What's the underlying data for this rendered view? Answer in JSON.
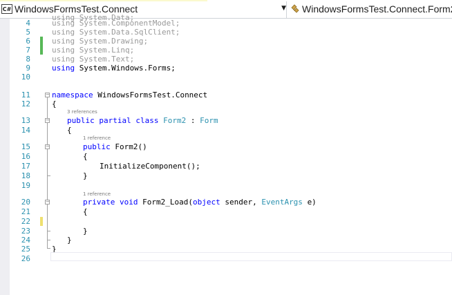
{
  "navbar": {
    "project_badge": "C#",
    "project": "WindowsFormsTest.Connect",
    "class_name": "WindowsFormsTest.Connect.Form2",
    "accent_color": "#007acc"
  },
  "editor": {
    "lines": [
      {
        "n": "4",
        "text": "using System.ComponentModel;"
      },
      {
        "n": "5",
        "text": "using System.Data.SqlClient;"
      },
      {
        "n": "6",
        "text": "using System.Drawing;"
      },
      {
        "n": "7",
        "text": "using System.Linq;"
      },
      {
        "n": "8",
        "text": "using System.Text;"
      },
      {
        "n": "9",
        "text": "using System.Windows.Forms;"
      },
      {
        "n": "10",
        "text": ""
      },
      {
        "n": "11",
        "text": "namespace WindowsFormsTest.Connect"
      },
      {
        "n": "12",
        "text": "{"
      },
      {
        "n": "13",
        "text": "public partial class Form2 : Form"
      },
      {
        "n": "14",
        "text": "{"
      },
      {
        "n": "15",
        "text": "public Form2()"
      },
      {
        "n": "16",
        "text": "{"
      },
      {
        "n": "17",
        "text": "InitializeComponent();"
      },
      {
        "n": "18",
        "text": "}"
      },
      {
        "n": "19",
        "text": ""
      },
      {
        "n": "20",
        "text": "private void Form2_Load(object sender, EventArgs e)"
      },
      {
        "n": "21",
        "text": "{"
      },
      {
        "n": "22",
        "text": ""
      },
      {
        "n": "23",
        "text": "}"
      },
      {
        "n": "24",
        "text": "}"
      },
      {
        "n": "25",
        "text": "}"
      },
      {
        "n": "26",
        "text": ""
      }
    ],
    "top_partial_line": "using System.Data;",
    "codelens": {
      "class_refs": "3 references",
      "ctor_refs": "1 reference",
      "load_refs": "1 reference"
    },
    "tokens": {
      "using": "using",
      "namespace": "namespace",
      "public": "public",
      "partial": "partial",
      "class": "class",
      "private": "private",
      "void": "void",
      "object": "object",
      "ns_name": "WindowsFormsTest.Connect",
      "class_name": "Form2",
      "colon": ":",
      "base_type": "Form",
      "ctor": "Form2()",
      "init_call": "InitializeComponent();",
      "load_method": "Form2_Load(",
      "sender": "sender,",
      "event_args": "EventArgs",
      "e_param": "e)",
      "open_brace": "{",
      "close_brace": "}"
    },
    "change_colors": {
      "saved": "#57b857",
      "unsaved": "#efe06f"
    }
  }
}
